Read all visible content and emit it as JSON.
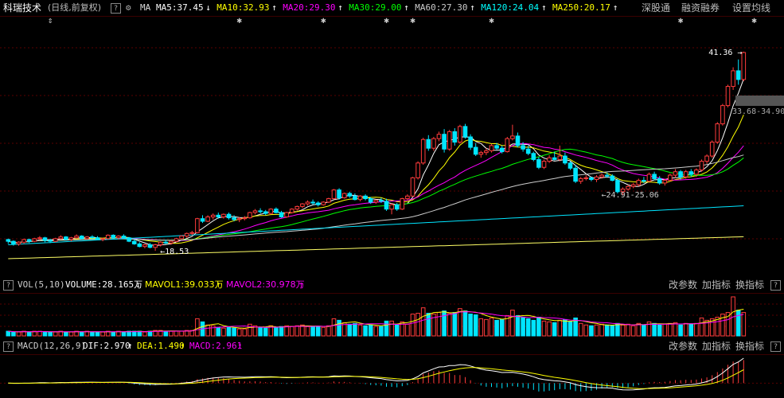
{
  "header": {
    "title": "科瑞技术",
    "period": "(日线,前复权)",
    "ma_label": "MA",
    "indicators": [
      {
        "text": "MA5:37.45",
        "color": "#ffffff",
        "arrow": "↓"
      },
      {
        "text": "MA10:32.93",
        "color": "#ffff00",
        "arrow": "↑"
      },
      {
        "text": "MA20:29.30",
        "color": "#ff00ff",
        "arrow": "↑"
      },
      {
        "text": "MA30:29.00",
        "color": "#00ff00",
        "arrow": "↑"
      },
      {
        "text": "MA60:27.30",
        "color": "#cccccc",
        "arrow": "↑"
      },
      {
        "text": "MA120:24.04",
        "color": "#00ffff",
        "arrow": "↑"
      },
      {
        "text": "MA250:20.17",
        "color": "#ffff00",
        "arrow": "↑"
      }
    ],
    "buttons": [
      "深股通",
      "融资融券",
      "设置均线"
    ],
    "help": "?"
  },
  "price_annotations": {
    "high": "41.36",
    "low": "18.53",
    "mid_low": "24.91-25.06",
    "cursor_range": "33.68-34.90"
  },
  "volume_header": {
    "label": "VOL(5,10)",
    "volume": "VOLUME:28.165万",
    "volume_arrow": "↓",
    "mavol1": "MAVOL1:39.033万",
    "mavol1_arrow": "↑",
    "mavol2": "MAVOL2:30.978万",
    "mavol2_arrow": "↑",
    "buttons": [
      "改参数",
      "加指标",
      "换指标"
    ]
  },
  "macd_header": {
    "label": "MACD(12,26,9)",
    "dif": "DIF:2.970",
    "dif_arrow": "↑",
    "dea": "DEA:1.490",
    "dea_arrow": "↑",
    "macd": "MACD:2.961",
    "macd_arrow": "↑",
    "buttons": [
      "改参数",
      "加指标",
      "换指标"
    ]
  },
  "colors": {
    "up": "#ff3b3b",
    "down": "#00e5ff",
    "grid": "#5a0000"
  },
  "chart_data": {
    "type": "candlestick",
    "y_range": [
      16.5,
      44.5
    ],
    "markers_at_index": [
      8,
      44,
      60,
      72,
      77,
      92,
      128,
      142
    ],
    "candles": [
      [
        19.8,
        19.9,
        19.3,
        19.6
      ],
      [
        19.6,
        19.7,
        19.1,
        19.3
      ],
      [
        19.3,
        19.6,
        19.1,
        19.5
      ],
      [
        19.5,
        19.9,
        19.3,
        19.8
      ],
      [
        19.8,
        19.9,
        19.4,
        19.6
      ],
      [
        19.6,
        20.0,
        19.5,
        19.9
      ],
      [
        19.9,
        20.2,
        19.7,
        20.0
      ],
      [
        20.0,
        20.1,
        19.5,
        19.7
      ],
      [
        19.7,
        19.9,
        19.4,
        19.6
      ],
      [
        19.6,
        20.0,
        19.5,
        19.9
      ],
      [
        19.9,
        20.3,
        19.8,
        20.1
      ],
      [
        20.1,
        20.2,
        19.7,
        19.8
      ],
      [
        19.8,
        20.1,
        19.6,
        20.0
      ],
      [
        20.0,
        20.4,
        19.9,
        20.2
      ],
      [
        20.2,
        20.3,
        19.8,
        19.9
      ],
      [
        19.9,
        20.2,
        19.8,
        20.1
      ],
      [
        20.1,
        20.3,
        19.9,
        20.0
      ],
      [
        20.0,
        20.2,
        19.7,
        19.8
      ],
      [
        19.8,
        20.0,
        19.6,
        19.9
      ],
      [
        19.9,
        20.4,
        19.8,
        20.3
      ],
      [
        20.3,
        20.4,
        19.9,
        20.0
      ],
      [
        20.0,
        20.3,
        19.8,
        20.2
      ],
      [
        20.2,
        20.4,
        19.9,
        20.0
      ],
      [
        20.0,
        20.1,
        19.5,
        19.6
      ],
      [
        19.6,
        19.8,
        19.2,
        19.3
      ],
      [
        19.3,
        19.5,
        18.9,
        19.0
      ],
      [
        19.0,
        19.3,
        18.8,
        19.2
      ],
      [
        19.2,
        19.4,
        18.8,
        18.9
      ],
      [
        18.9,
        19.3,
        18.5,
        19.2
      ],
      [
        19.2,
        19.6,
        19.0,
        19.5
      ],
      [
        19.5,
        19.8,
        19.3,
        19.4
      ],
      [
        19.4,
        19.7,
        19.2,
        19.6
      ],
      [
        19.6,
        20.0,
        19.5,
        19.9
      ],
      [
        19.9,
        20.3,
        19.8,
        20.2
      ],
      [
        20.2,
        20.6,
        20.0,
        20.5
      ],
      [
        20.5,
        20.8,
        20.3,
        20.6
      ],
      [
        20.6,
        22.3,
        20.5,
        22.2
      ],
      [
        22.2,
        22.6,
        21.7,
        21.9
      ],
      [
        21.9,
        22.6,
        21.8,
        22.4
      ],
      [
        22.4,
        22.8,
        22.1,
        22.6
      ],
      [
        22.6,
        22.9,
        22.2,
        22.4
      ],
      [
        22.4,
        22.8,
        22.2,
        22.7
      ],
      [
        22.7,
        22.9,
        22.1,
        22.3
      ],
      [
        22.3,
        22.6,
        21.9,
        22.1
      ],
      [
        22.1,
        22.4,
        21.8,
        22.2
      ],
      [
        22.2,
        22.5,
        22.0,
        22.3
      ],
      [
        22.3,
        23.0,
        22.2,
        22.9
      ],
      [
        22.9,
        23.3,
        22.7,
        23.1
      ],
      [
        23.1,
        23.4,
        22.8,
        23.0
      ],
      [
        23.0,
        23.2,
        22.6,
        22.8
      ],
      [
        22.8,
        23.4,
        22.7,
        23.3
      ],
      [
        23.3,
        23.5,
        22.8,
        22.9
      ],
      [
        22.9,
        23.1,
        22.3,
        22.4
      ],
      [
        22.4,
        23.0,
        22.3,
        22.9
      ],
      [
        22.9,
        23.4,
        22.8,
        23.3
      ],
      [
        23.3,
        23.7,
        23.1,
        23.6
      ],
      [
        23.6,
        24.0,
        23.4,
        23.9
      ],
      [
        23.9,
        24.3,
        23.7,
        24.1
      ],
      [
        24.1,
        24.4,
        23.8,
        24.0
      ],
      [
        24.0,
        24.2,
        23.6,
        23.8
      ],
      [
        23.8,
        24.2,
        23.7,
        24.1
      ],
      [
        24.1,
        24.6,
        24.0,
        24.5
      ],
      [
        24.5,
        25.6,
        24.4,
        25.5
      ],
      [
        25.5,
        25.7,
        24.4,
        24.6
      ],
      [
        24.6,
        25.2,
        24.5,
        25.1
      ],
      [
        25.1,
        25.3,
        24.6,
        24.8
      ],
      [
        24.8,
        25.1,
        24.3,
        24.4
      ],
      [
        24.4,
        24.9,
        24.2,
        24.8
      ],
      [
        24.8,
        25.0,
        24.3,
        24.5
      ],
      [
        24.5,
        24.7,
        23.9,
        24.1
      ],
      [
        24.1,
        24.4,
        23.9,
        24.3
      ],
      [
        24.3,
        24.6,
        24.0,
        24.2
      ],
      [
        24.2,
        24.5,
        23.1,
        23.3
      ],
      [
        23.3,
        24.0,
        22.7,
        23.8
      ],
      [
        23.8,
        24.0,
        23.1,
        23.3
      ],
      [
        23.3,
        24.6,
        23.2,
        24.5
      ],
      [
        24.5,
        25.0,
        24.3,
        24.8
      ],
      [
        24.8,
        27.0,
        24.7,
        26.9
      ],
      [
        26.9,
        28.8,
        26.7,
        28.6
      ],
      [
        28.6,
        31.5,
        28.4,
        31.3
      ],
      [
        31.3,
        31.8,
        30.0,
        30.3
      ],
      [
        30.3,
        31.6,
        30.0,
        31.4
      ],
      [
        31.4,
        32.2,
        31.1,
        31.9
      ],
      [
        31.9,
        32.5,
        29.8,
        30.2
      ],
      [
        30.2,
        32.4,
        30.0,
        32.2
      ],
      [
        32.2,
        32.6,
        30.6,
        31.0
      ],
      [
        31.0,
        33.0,
        30.8,
        32.8
      ],
      [
        32.8,
        33.1,
        31.4,
        31.6
      ],
      [
        31.6,
        31.9,
        30.1,
        30.4
      ],
      [
        30.4,
        30.9,
        29.4,
        29.6
      ],
      [
        29.6,
        30.0,
        29.2,
        29.8
      ],
      [
        29.8,
        30.3,
        29.5,
        30.0
      ],
      [
        30.0,
        30.8,
        29.8,
        30.6
      ],
      [
        30.6,
        30.9,
        30.1,
        30.3
      ],
      [
        30.3,
        30.6,
        29.7,
        29.9
      ],
      [
        29.9,
        31.6,
        29.8,
        31.4
      ],
      [
        31.4,
        33.0,
        31.2,
        31.7
      ],
      [
        31.7,
        32.1,
        30.4,
        30.6
      ],
      [
        30.6,
        31.0,
        29.9,
        30.2
      ],
      [
        30.2,
        30.6,
        29.5,
        29.7
      ],
      [
        29.7,
        29.9,
        28.8,
        29.0
      ],
      [
        29.0,
        29.3,
        27.9,
        28.1
      ],
      [
        28.1,
        29.0,
        27.9,
        28.8
      ],
      [
        28.8,
        29.5,
        28.6,
        29.2
      ],
      [
        29.2,
        29.9,
        28.9,
        29.0
      ],
      [
        29.0,
        30.6,
        28.8,
        29.4
      ],
      [
        29.4,
        29.8,
        28.4,
        28.6
      ],
      [
        28.6,
        28.8,
        27.8,
        28.0
      ],
      [
        28.0,
        28.4,
        26.3,
        26.5
      ],
      [
        26.5,
        27.0,
        26.2,
        26.8
      ],
      [
        26.8,
        27.2,
        26.6,
        26.9
      ],
      [
        26.9,
        27.0,
        26.5,
        26.7
      ],
      [
        26.7,
        27.2,
        26.4,
        27.0
      ],
      [
        27.0,
        27.4,
        26.8,
        27.2
      ],
      [
        27.2,
        27.5,
        26.9,
        27.1
      ],
      [
        27.1,
        27.3,
        26.5,
        26.6
      ],
      [
        26.6,
        26.8,
        25.1,
        25.3
      ],
      [
        25.3,
        25.8,
        24.9,
        25.6
      ],
      [
        25.6,
        26.1,
        25.4,
        25.9
      ],
      [
        25.9,
        26.3,
        25.7,
        26.1
      ],
      [
        26.1,
        26.8,
        25.9,
        26.6
      ],
      [
        26.6,
        27.0,
        26.3,
        26.5
      ],
      [
        26.5,
        27.5,
        26.4,
        27.3
      ],
      [
        27.3,
        27.6,
        26.6,
        26.8
      ],
      [
        26.8,
        27.1,
        26.1,
        26.3
      ],
      [
        26.3,
        26.8,
        26.0,
        26.6
      ],
      [
        26.6,
        27.4,
        26.5,
        27.2
      ],
      [
        27.2,
        27.9,
        26.9,
        27.6
      ],
      [
        27.6,
        27.8,
        26.7,
        27.0
      ],
      [
        27.0,
        27.8,
        26.8,
        27.6
      ],
      [
        27.6,
        27.9,
        27.0,
        27.3
      ],
      [
        27.3,
        28.0,
        27.0,
        27.8
      ],
      [
        27.8,
        29.0,
        27.6,
        28.8
      ],
      [
        28.8,
        29.6,
        28.5,
        29.4
      ],
      [
        29.4,
        31.2,
        29.2,
        31.0
      ],
      [
        31.0,
        33.3,
        30.8,
        33.1
      ],
      [
        33.1,
        35.4,
        32.9,
        35.2
      ],
      [
        35.2,
        37.6,
        35.0,
        37.4
      ],
      [
        37.4,
        39.6,
        37.0,
        39.2
      ],
      [
        39.2,
        40.5,
        37.6,
        38.2
      ],
      [
        38.2,
        41.4,
        38.0,
        41.3
      ]
    ],
    "volume": [
      0.6,
      0.5,
      0.5,
      0.6,
      0.5,
      0.6,
      0.6,
      0.5,
      0.5,
      0.5,
      0.6,
      0.5,
      0.5,
      0.6,
      0.5,
      0.6,
      0.5,
      0.5,
      0.5,
      0.6,
      0.5,
      0.6,
      0.5,
      0.6,
      0.6,
      0.6,
      0.5,
      0.6,
      0.7,
      0.7,
      0.6,
      0.6,
      0.6,
      0.6,
      0.7,
      0.7,
      2.2,
      1.8,
      1.4,
      1.3,
      1.1,
      1.0,
      1.1,
      1.0,
      0.9,
      0.9,
      1.5,
      1.3,
      1.1,
      1.0,
      1.3,
      1.1,
      1.2,
      1.3,
      1.2,
      1.3,
      1.4,
      1.2,
      1.2,
      1.2,
      1.1,
      1.3,
      2.2,
      2.0,
      1.7,
      1.5,
      1.6,
      1.4,
      1.3,
      1.4,
      1.2,
      1.2,
      1.9,
      1.9,
      1.4,
      1.8,
      1.5,
      2.8,
      2.9,
      3.6,
      2.9,
      2.8,
      3.0,
      3.2,
      2.9,
      3.0,
      3.5,
      3.2,
      2.8,
      2.7,
      2.2,
      2.1,
      2.3,
      2.0,
      2.1,
      2.6,
      3.3,
      2.6,
      2.4,
      2.2,
      2.0,
      2.4,
      1.9,
      1.8,
      1.7,
      2.0,
      2.1,
      1.8,
      2.3,
      1.6,
      1.4,
      1.3,
      1.4,
      1.5,
      1.4,
      1.3,
      1.6,
      1.4,
      1.5,
      1.3,
      1.6,
      1.4,
      1.8,
      1.6,
      1.4,
      1.5,
      1.6,
      1.7,
      1.4,
      1.6,
      1.5,
      1.6,
      2.3,
      2.0,
      2.2,
      2.4,
      2.8,
      3.0,
      5.0,
      3.3,
      3.0
    ],
    "macd_range": [
      -1.6,
      3.2
    ]
  }
}
